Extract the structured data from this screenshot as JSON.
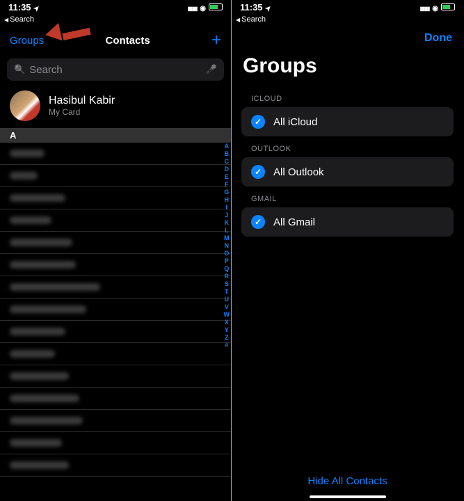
{
  "status": {
    "time": "11:35",
    "back_label": "Search"
  },
  "left": {
    "nav": {
      "groups": "Groups",
      "title": "Contacts",
      "add": "+"
    },
    "search": {
      "placeholder": "Search"
    },
    "mycard": {
      "name": "Hasibul Kabir",
      "sub": "My Card"
    },
    "section": "A",
    "index": [
      "A",
      "B",
      "C",
      "D",
      "E",
      "F",
      "G",
      "H",
      "I",
      "J",
      "K",
      "L",
      "M",
      "N",
      "O",
      "P",
      "Q",
      "R",
      "S",
      "T",
      "U",
      "V",
      "W",
      "X",
      "Y",
      "Z",
      "#"
    ]
  },
  "right": {
    "done": "Done",
    "title": "Groups",
    "sections": [
      {
        "label": "ICLOUD",
        "item": "All iCloud"
      },
      {
        "label": "OUTLOOK",
        "item": "All Outlook"
      },
      {
        "label": "GMAIL",
        "item": "All Gmail"
      }
    ],
    "hide": "Hide All Contacts"
  }
}
